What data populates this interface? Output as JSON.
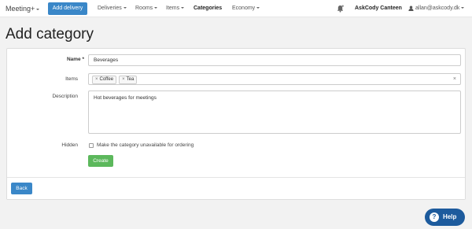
{
  "navbar": {
    "brand": "Meeting+",
    "add_delivery": "Add delivery",
    "menu": [
      "Deliveries",
      "Rooms",
      "Items",
      "Categories",
      "Economy"
    ],
    "bell_icon": "bell-icon",
    "org": "AskCody Canteen",
    "user": "allan@askcody.dk"
  },
  "page": {
    "title": "Add category"
  },
  "form": {
    "name_label": "Name *",
    "name_value": "Beverages",
    "items_label": "Items",
    "items_tags": [
      "Coffee",
      "Tea"
    ],
    "description_label": "Description",
    "description_value": "Hot beverages for meetings",
    "hidden_label": "Hidden",
    "hidden_checkbox_label": "Make the category unavailable for ordering",
    "hidden_checked": false,
    "create_button": "Create"
  },
  "footer": {
    "back_button": "Back"
  },
  "help": {
    "label": "Help",
    "icon": "question-icon"
  },
  "colors": {
    "primary": "#3a87c8",
    "success": "#5cb85c",
    "help": "#1d5b9d"
  }
}
